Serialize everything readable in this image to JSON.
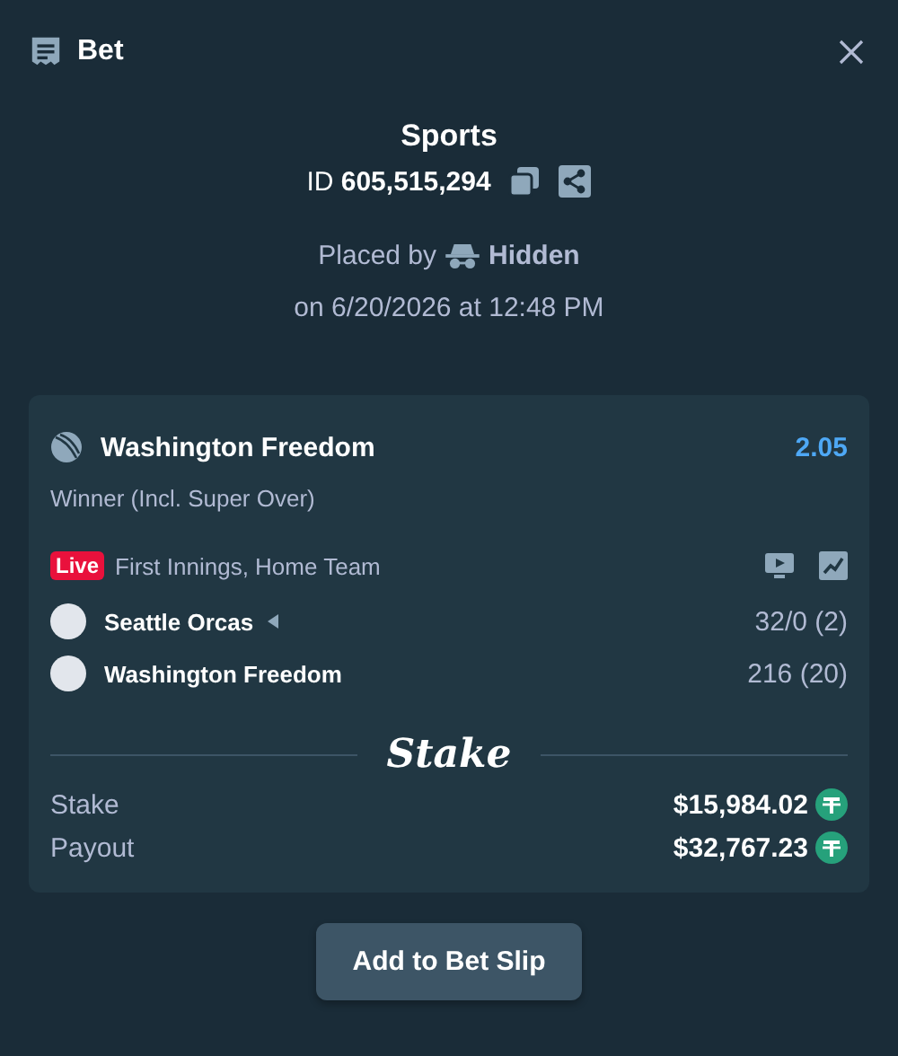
{
  "header": {
    "title": "Bet"
  },
  "summary": {
    "category": "Sports",
    "id_label": "ID",
    "id_value": "605,515,294",
    "placed_by_label": "Placed by",
    "placed_by_user": "Hidden",
    "placed_on": "on 6/20/2026 at 12:48 PM"
  },
  "selection": {
    "name": "Washington Freedom",
    "odds": "2.05",
    "market": "Winner (Incl. Super Over)",
    "live_badge": "Live",
    "status": "First Innings, Home Team",
    "teams": [
      {
        "name": "Seattle Orcas",
        "batting": true,
        "score": "32/0 (2)"
      },
      {
        "name": "Washington Freedom",
        "batting": false,
        "score": "216 (20)"
      }
    ]
  },
  "brand": "Stake",
  "amounts": [
    {
      "label": "Stake",
      "value": "$15,984.02"
    },
    {
      "label": "Payout",
      "value": "$32,767.23"
    }
  ],
  "button": "Add to Bet Slip"
}
